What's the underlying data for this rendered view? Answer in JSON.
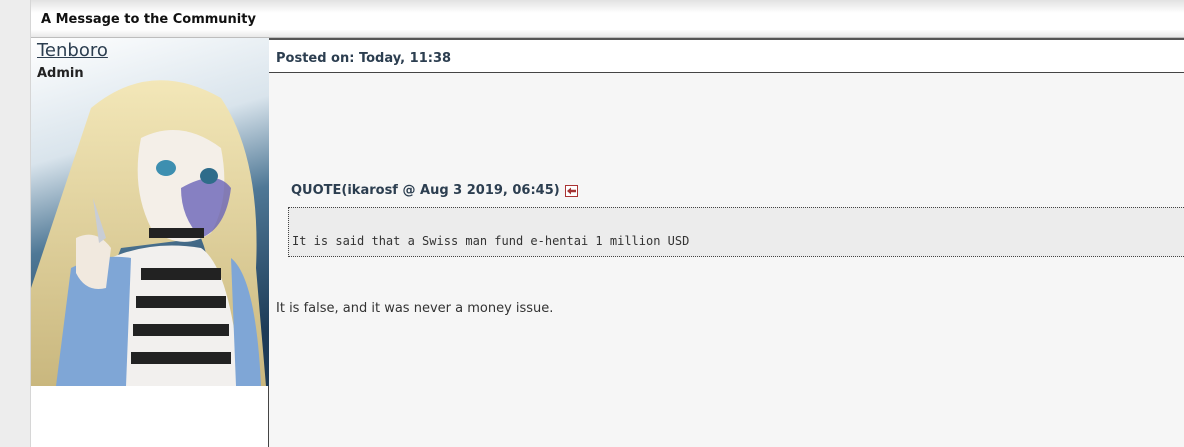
{
  "topic": {
    "title": "A Message to the Community"
  },
  "author": {
    "name": "Tenboro",
    "rank": "Admin",
    "avatar_icon": "anime-avatar-icon"
  },
  "post": {
    "posted_on": "Posted on: Today, 11:38",
    "quote_header": "QUOTE(ikarosf @ Aug 3 2019, 06:45)",
    "quote_text": "It is said that a Swiss man fund e-hentai 1 million USD",
    "reply_text": "It is false, and it was never a money issue."
  },
  "colors": {
    "header_text": "#2c3e50",
    "quote_bg": "#ececec",
    "post_bg": "#f6f6f6",
    "jump_icon": "#a33333"
  }
}
